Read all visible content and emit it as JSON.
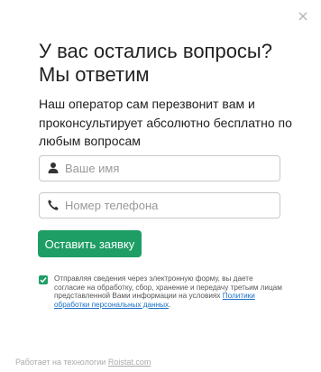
{
  "title_line1": "У вас остались вопросы?",
  "title_line2": "Мы ответим",
  "subtitle": "Наш оператор сам перезвонит вам и проконсультирует абсолютно бесплатно по любым вопросам",
  "form": {
    "name_placeholder": "Ваше имя",
    "phone_placeholder": "Номер телефона",
    "submit_label": "Оставить заявку"
  },
  "consent": {
    "checked": true,
    "text": "Отправляя сведения через электронную форму, вы даете согласие на обработку, сбор, хранение и передачу третьим лицам представленной Вами информации на условиях",
    "link_text": "Политики обработки персональных данных",
    "tail": "."
  },
  "footer": {
    "prefix": "Работает на технологии",
    "link_text": "Roistat.com"
  },
  "icons": {
    "close": "close-icon",
    "user": "user-icon",
    "phone": "phone-icon",
    "check": "check-icon"
  },
  "colors": {
    "accent": "#1e9e65",
    "link": "#1a6fc4",
    "muted": "#aaaaaa"
  }
}
